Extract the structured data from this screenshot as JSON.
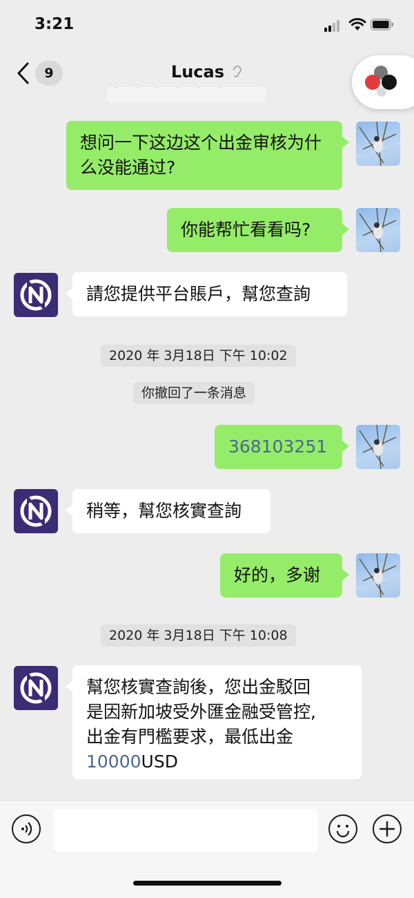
{
  "status_bar": {
    "time": "3:21"
  },
  "nav": {
    "back_count": "9",
    "title": "Lucas"
  },
  "messages": [
    {
      "from": "me",
      "text": "想问一下这边这个出金审核为什么没能通过?"
    },
    {
      "from": "me",
      "text": "你能帮忙看看吗?"
    },
    {
      "from": "service",
      "text": "請您提供平台賬戶，幫您查詢"
    },
    {
      "type": "timestamp",
      "text": "2020 年 3月18日 下午 10:02"
    },
    {
      "type": "system",
      "text": "你撤回了一条消息"
    },
    {
      "from": "me",
      "text": "368103251"
    },
    {
      "from": "service",
      "text": "稍等，幫您核實查詢"
    },
    {
      "from": "me",
      "text": "好的，多谢"
    },
    {
      "type": "timestamp",
      "text": "2020 年 3月18日 下午 10:08"
    },
    {
      "from": "service",
      "text_lines": [
        "幫您核實查詢後，您出金駁回",
        "是因新加坡受外匯金融受管控,",
        "出金有門檻要求，最低出金"
      ],
      "amount": "10000",
      "unit": "USD"
    }
  ],
  "icons": {
    "voice": "voice-mode-icon",
    "emoji": "emoji-icon",
    "more": "plus-icon"
  },
  "colors": {
    "my_bubble": "#95ec69",
    "their_bubble": "#ffffff",
    "background": "#ededed",
    "link_number": "#4a6790"
  }
}
